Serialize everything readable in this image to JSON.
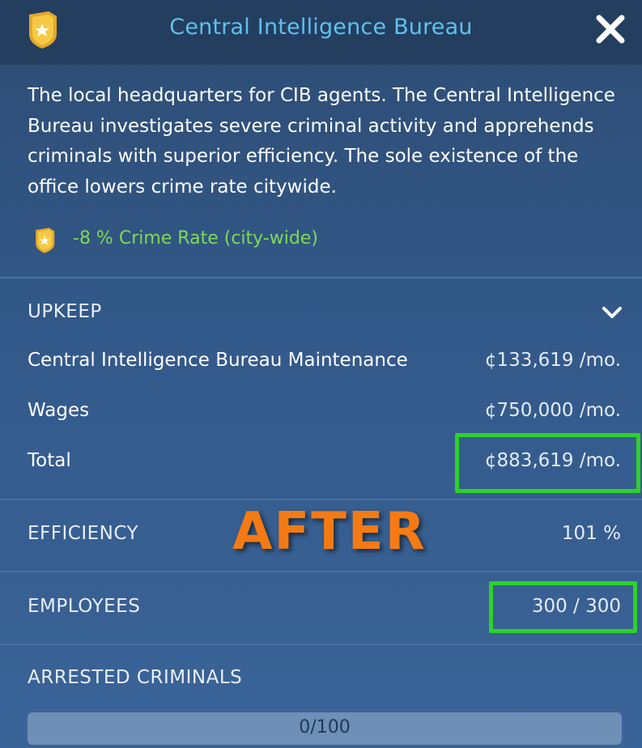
{
  "header": {
    "title": "Central Intelligence Bureau",
    "icon": "police-badge-icon",
    "close_icon": "close-icon"
  },
  "description": "The local headquarters for CIB agents. The Central Intelligence Bureau investigates severe criminal activity and apprehends criminals with superior efficiency. The sole existence of the office lowers crime rate citywide.",
  "effect": {
    "icon": "police-badge-icon",
    "text": "-8 % Crime Rate (city-wide)",
    "color": "#7ed957"
  },
  "upkeep": {
    "label": "UPKEEP",
    "toggle_icon": "chevron-down-icon",
    "rows": [
      {
        "label": "Central Intelligence Bureau Maintenance",
        "value": "¢133,619 /mo."
      },
      {
        "label": "Wages",
        "value": "¢750,000 /mo."
      },
      {
        "label": "Total",
        "value": "¢883,619 /mo."
      }
    ]
  },
  "efficiency": {
    "label": "EFFICIENCY",
    "value": "101 %"
  },
  "employees": {
    "label": "EMPLOYEES",
    "value": "300 / 300"
  },
  "arrested": {
    "label": "ARRESTED CRIMINALS",
    "progress_text": "0/100",
    "progress": 0
  },
  "overlay": {
    "text": "AFTER",
    "color": "#f47a14"
  },
  "colors": {
    "title": "#5fc1ee",
    "highlight": "#2ed12a",
    "header_bg": "#243e5f"
  }
}
